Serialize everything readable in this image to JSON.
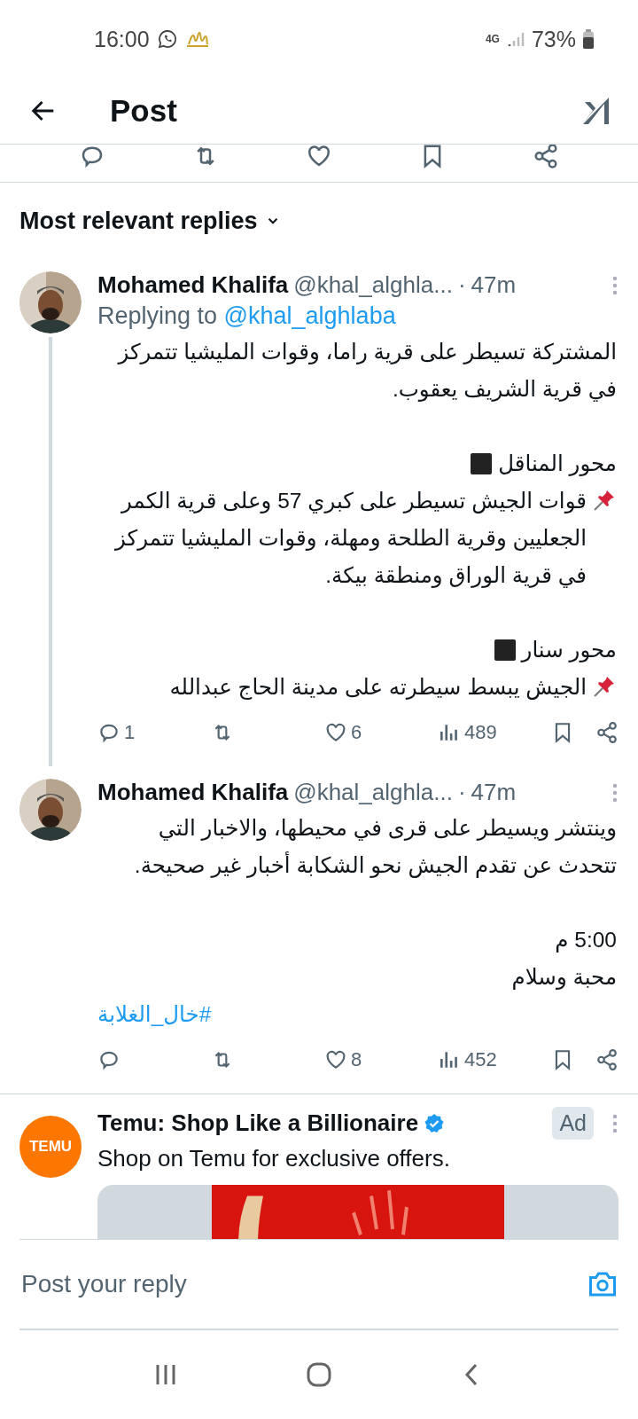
{
  "status_bar": {
    "time": "16:00",
    "network": "4G",
    "battery": "73%"
  },
  "header": {
    "title": "Post"
  },
  "sort": {
    "label": "Most relevant replies"
  },
  "replies": [
    {
      "name": "Mohamed Khalifa",
      "handle": "@khal_alghla...",
      "separator": "·",
      "time": "47m",
      "replying_to": {
        "prefix": "Replying to",
        "handle": "@khal_alghlaba"
      },
      "thread_continues": true,
      "blocks": [
        {
          "kind": "text",
          "text": "المشتركة تسيطر على قرية راما، وقوات المليشيا تتمركز في قرية الشريف يعقوب."
        },
        {
          "kind": "gap"
        },
        {
          "kind": "heading",
          "text": "محور المناقل"
        },
        {
          "kind": "pin",
          "text": "قوات الجيش تسيطر على كبري 57 وعلى قرية الكمر الجعليين وقرية الطلحة ومهلة، وقوات المليشيا تتمركز في قرية الوراق ومنطقة بيكة."
        },
        {
          "kind": "gap"
        },
        {
          "kind": "heading",
          "text": "محور سنار"
        },
        {
          "kind": "pin",
          "text": "الجيش يبسط سيطرته على مدينة الحاج عبدالله"
        }
      ],
      "stats": {
        "replies": "1",
        "likes": "6",
        "views": "489"
      }
    },
    {
      "name": "Mohamed Khalifa",
      "handle": "@khal_alghla...",
      "separator": "·",
      "time": "47m",
      "thread_continues": false,
      "blocks": [
        {
          "kind": "text",
          "text": "وينتشر ويسيطر على قرى في محيطها، والاخبار التي تتحدث عن تقدم الجيش نحو الشكابة أخبار غير صحيحة."
        },
        {
          "kind": "gap"
        },
        {
          "kind": "text",
          "text": "5:00 م"
        },
        {
          "kind": "text",
          "text": "محبة وسلام"
        },
        {
          "kind": "hashtag",
          "text": "#خال_الغلابة"
        }
      ],
      "stats": {
        "likes": "8",
        "views": "452"
      }
    }
  ],
  "ad": {
    "logo": "TEMU",
    "name": "Temu: Shop Like a Billionaire",
    "verified": true,
    "badge": "Ad",
    "text": "Shop on Temu for exclusive offers."
  },
  "composer": {
    "placeholder": "Post your reply"
  }
}
